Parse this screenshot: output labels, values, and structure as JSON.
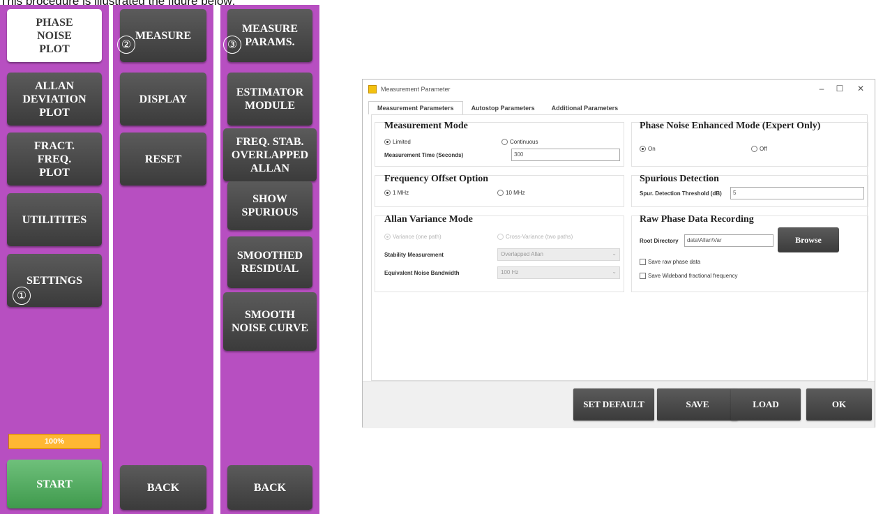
{
  "caption": "This procedure is illustrated the figure below:",
  "column1": {
    "phase_noise_plot": "PHASE\nNOISE\nPLOT",
    "allan_deviation_plot": "ALLAN\nDEVIATION\nPLOT",
    "fract_freq_plot": "FRACT.\nFREQ.\nPLOT",
    "utilities": "UTILITITES",
    "settings": "SETTINGS",
    "progress_text": "100%",
    "progress_fraction": 1.0,
    "start": "START"
  },
  "column2": {
    "measure": "MEASURE",
    "display": "DISPLAY",
    "reset": "RESET",
    "back": "BACK"
  },
  "column3": {
    "measure_params": "MEASURE\nPARAMS.",
    "estimator_module": "ESTIMATOR\nMODULE",
    "freq_stab": "FREQ. STAB.\nOVERLAPPED\nALLAN",
    "show_spurious": "SHOW\nSPURIOUS",
    "smoothed_residual": "SMOOTHED\nRESIDUAL",
    "smooth_noise_curve": "SMOOTH\nNOISE CURVE",
    "back": "BACK"
  },
  "markers": {
    "m1": "①",
    "m2": "②",
    "m3": "③"
  },
  "dialog": {
    "title": "Measurement Parameter",
    "controls": {
      "minimize": "–",
      "maximize": "☐",
      "close": "✕"
    },
    "tabs": [
      "Measurement Parameters",
      "Autostop Parameters",
      "Additional Parameters"
    ],
    "measurement_mode": {
      "title": "Measurement Mode",
      "limited": "Limited",
      "continuous": "Continuous",
      "time_label": "Measurement Time (Seconds)",
      "time_value": "300"
    },
    "enhanced_mode": {
      "title": "Phase Noise Enhanced Mode (Expert Only)",
      "on": "On",
      "off": "Off"
    },
    "freq_offset": {
      "title": "Frequency Offset Option",
      "opt1": "1 MHz",
      "opt2": "10 MHz"
    },
    "spurious": {
      "title": "Spurious Detection",
      "threshold_label": "Spur. Detection Threshold (dB)",
      "threshold_value": "5"
    },
    "allan": {
      "title": "Allan Variance Mode",
      "variance": "Variance (one path)",
      "cross_variance": "Cross-Variance (two paths)",
      "stability_label": "Stability Measurement",
      "stability_value": "Overlapped Allan",
      "bandwidth_label": "Equivalent Noise Bandwidth",
      "bandwidth_value": "100 Hz"
    },
    "raw": {
      "title": "Raw Phase Data Recording",
      "root_label": "Root Directory",
      "root_value": "data\\Allan\\Var",
      "browse": "Browse",
      "save_raw": "Save raw phase data",
      "save_fractional": "Save Wideband fractional frequency"
    },
    "footer": {
      "set_default": "SET DEFAULT",
      "save": "SAVE",
      "load": "LOAD",
      "ok": "OK"
    }
  }
}
